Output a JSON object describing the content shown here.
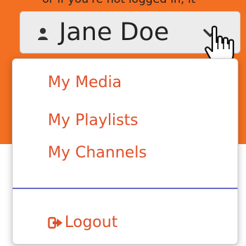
{
  "top_strip_text": "or if you're not logged in, it",
  "user_menu": {
    "icon": "user-icon",
    "name": "Jane Doe",
    "toggle_icon": "chevron-down-icon"
  },
  "cursor": "hand-pointer-icon",
  "dropdown": {
    "items": [
      {
        "label": "My Media"
      },
      {
        "label": "My Playlists"
      },
      {
        "label": "My Channels"
      }
    ],
    "logout": {
      "icon": "sign-out-icon",
      "label": "Logout"
    }
  },
  "colors": {
    "header": "#f36f21",
    "link": "#e0502a",
    "divider": "#6b6fc9",
    "button_bg": "#ececec"
  }
}
